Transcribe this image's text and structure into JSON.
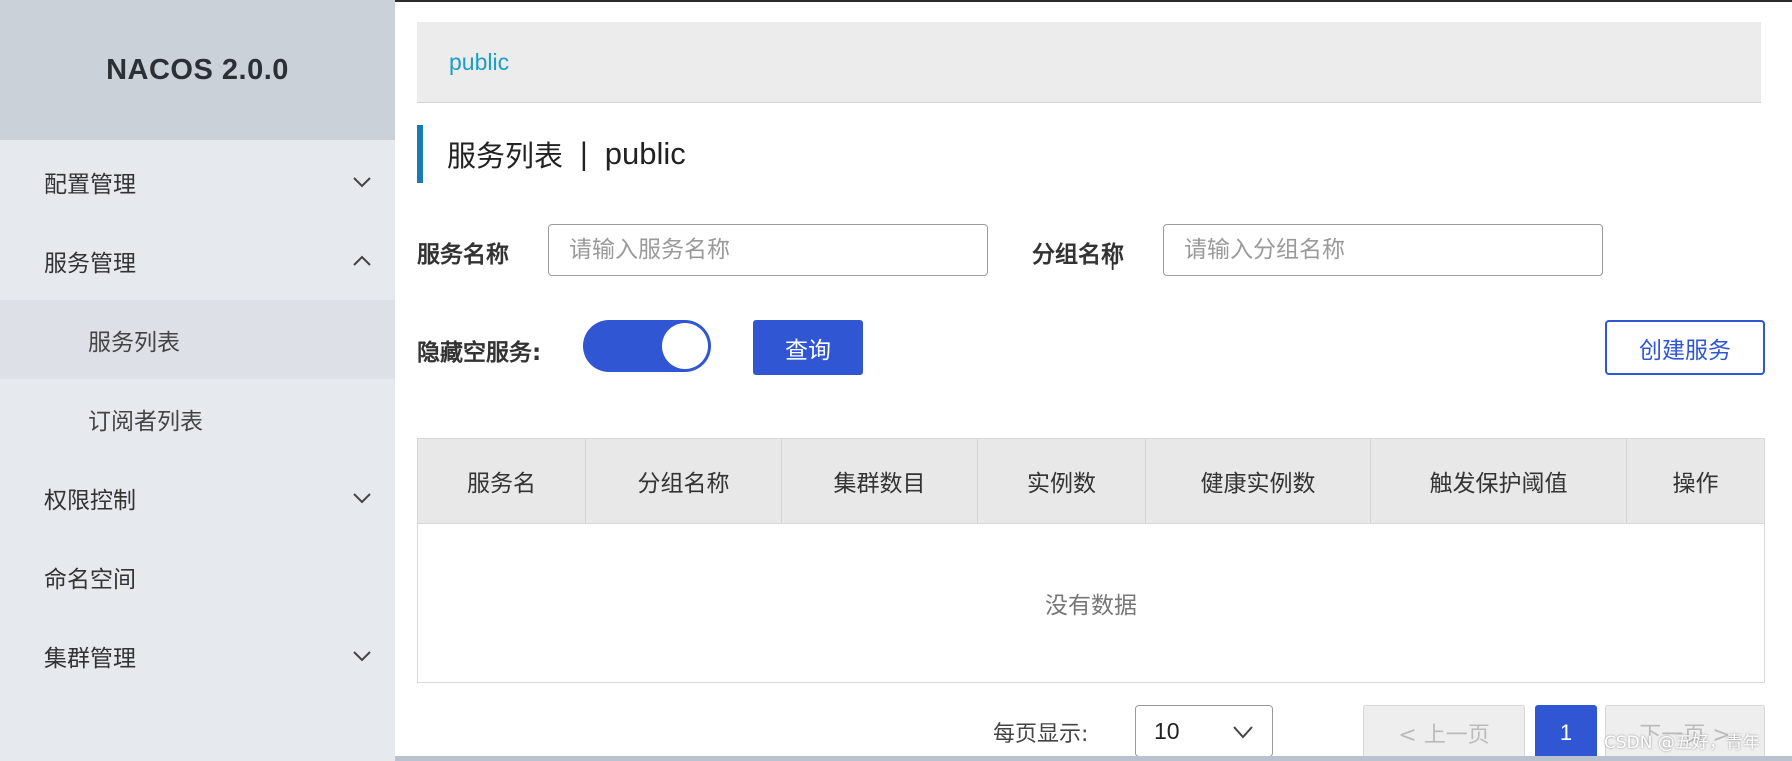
{
  "sidebar": {
    "logo": "NACOS 2.0.0",
    "items": [
      {
        "label": "配置管理",
        "chevron": "down"
      },
      {
        "label": "服务管理",
        "chevron": "up"
      },
      {
        "label": "服务列表"
      },
      {
        "label": "订阅者列表"
      },
      {
        "label": "权限控制",
        "chevron": "down"
      },
      {
        "label": "命名空间"
      },
      {
        "label": "集群管理",
        "chevron": "down"
      }
    ]
  },
  "namespace_bar": {
    "active": "public"
  },
  "page": {
    "title": "服务列表",
    "separator": "|",
    "namespace": "public"
  },
  "filters": {
    "service_name_label": "服务名称",
    "service_name_placeholder": "请输入服务名称",
    "group_name_label": "分组名称",
    "group_name_placeholder": "请输入分组名称",
    "hide_empty_label": "隐藏空服务:",
    "hide_empty_on": true,
    "query_button": "查询",
    "create_button": "创建服务"
  },
  "table": {
    "columns": [
      "服务名",
      "分组名称",
      "集群数目",
      "实例数",
      "健康实例数",
      "触发保护阈值",
      "操作"
    ],
    "rows": [],
    "empty_text": "没有数据"
  },
  "pagination": {
    "per_page_label": "每页显示:",
    "per_page": "10",
    "prev": "< 上一页",
    "current": "1",
    "next": "下一页 >"
  },
  "overlay": {
    "watermark": "CSDN @五好，青年"
  },
  "colors": {
    "primary": "#3056d3",
    "namespace_link": "#1a9fc6",
    "accent_bar": "#1a7ab8"
  }
}
